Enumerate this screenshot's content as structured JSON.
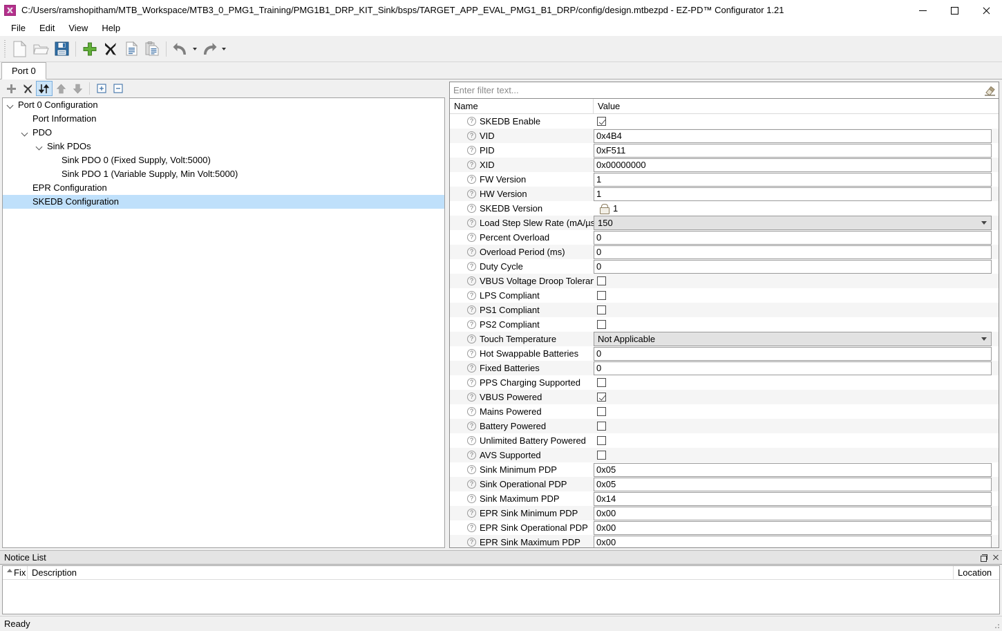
{
  "window": {
    "title": "C:/Users/ramshopitham/MTB_Workspace/MTB3_0_PMG1_Training/PMG1B1_DRP_KIT_Sink/bsps/TARGET_APP_EVAL_PMG1_B1_DRP/config/design.mtbezpd - EZ-PD™ Configurator 1.21",
    "app_icon": "ezpd-app-icon",
    "minimize": "minimize-icon",
    "maximize": "maximize-icon",
    "close": "close-icon"
  },
  "menubar": {
    "items": [
      {
        "label": "File"
      },
      {
        "label": "Edit"
      },
      {
        "label": "View"
      },
      {
        "label": "Help"
      }
    ]
  },
  "toolbar": {
    "buttons": [
      {
        "name": "new-file-icon",
        "tip": "New"
      },
      {
        "name": "open-folder-icon",
        "tip": "Open"
      },
      {
        "name": "save-icon",
        "tip": "Save"
      },
      {
        "name": "add-icon",
        "tip": "Add"
      },
      {
        "name": "delete-icon",
        "tip": "Delete"
      },
      {
        "name": "copy-icon",
        "tip": "Copy"
      },
      {
        "name": "paste-icon",
        "tip": "Paste"
      },
      {
        "name": "undo-icon",
        "tip": "Undo"
      },
      {
        "name": "redo-icon",
        "tip": "Redo"
      }
    ]
  },
  "tabs": [
    {
      "label": "Port 0",
      "active": true
    }
  ],
  "tree_toolbar": {
    "buttons": [
      {
        "name": "tree-add-icon",
        "active": false
      },
      {
        "name": "tree-delete-icon",
        "active": false
      },
      {
        "name": "tree-sort-icon",
        "active": true
      },
      {
        "name": "tree-move-up-icon",
        "active": false
      },
      {
        "name": "tree-move-down-icon",
        "active": false
      },
      {
        "name": "tree-expand-all-icon",
        "active": false
      },
      {
        "name": "tree-collapse-all-icon",
        "active": false
      }
    ]
  },
  "tree": {
    "items": [
      {
        "label": "Port 0 Configuration",
        "indent": 0,
        "expandable": true,
        "expanded": true,
        "selected": false
      },
      {
        "label": "Port Information",
        "indent": 1,
        "expandable": false,
        "expanded": false,
        "selected": false
      },
      {
        "label": "PDO",
        "indent": 1,
        "expandable": true,
        "expanded": true,
        "selected": false
      },
      {
        "label": "Sink PDOs",
        "indent": 2,
        "expandable": true,
        "expanded": true,
        "selected": false
      },
      {
        "label": "Sink PDO 0 (Fixed Supply, Volt:5000)",
        "indent": 3,
        "expandable": false,
        "expanded": false,
        "selected": false
      },
      {
        "label": "Sink PDO 1 (Variable Supply, Min Volt:5000)",
        "indent": 3,
        "expandable": false,
        "expanded": false,
        "selected": false
      },
      {
        "label": "EPR Configuration",
        "indent": 1,
        "expandable": false,
        "expanded": false,
        "selected": false
      },
      {
        "label": "SKEDB Configuration",
        "indent": 1,
        "expandable": false,
        "expanded": false,
        "selected": true
      }
    ]
  },
  "filter": {
    "value": "",
    "placeholder": "Enter filter text...",
    "clear_icon": "eraser-icon"
  },
  "grid": {
    "columns": {
      "name": "Name",
      "value": "Value"
    },
    "rows": [
      {
        "name": "SKEDB Enable",
        "type": "checkbox",
        "checked": true,
        "value": ""
      },
      {
        "name": "VID",
        "type": "text",
        "value": "0x4B4"
      },
      {
        "name": "PID",
        "type": "text",
        "value": "0xF511"
      },
      {
        "name": "XID",
        "type": "text",
        "value": "0x00000000"
      },
      {
        "name": "FW Version",
        "type": "text",
        "value": "1"
      },
      {
        "name": "HW Version",
        "type": "text",
        "value": "1"
      },
      {
        "name": "SKEDB Version",
        "type": "locked",
        "value": "1"
      },
      {
        "name": "Load Step Slew Rate (mA/µs)",
        "type": "combo",
        "value": "150"
      },
      {
        "name": "Percent Overload",
        "type": "text",
        "value": "0"
      },
      {
        "name": "Overload Period (ms)",
        "type": "text",
        "value": "0"
      },
      {
        "name": "Duty Cycle",
        "type": "text",
        "value": "0"
      },
      {
        "name": "VBUS Voltage Droop Tolerance",
        "type": "checkbox",
        "checked": false,
        "value": ""
      },
      {
        "name": "LPS Compliant",
        "type": "checkbox",
        "checked": false,
        "value": ""
      },
      {
        "name": "PS1 Compliant",
        "type": "checkbox",
        "checked": false,
        "value": ""
      },
      {
        "name": "PS2 Compliant",
        "type": "checkbox",
        "checked": false,
        "value": ""
      },
      {
        "name": "Touch Temperature",
        "type": "combo",
        "value": "Not Applicable"
      },
      {
        "name": "Hot Swappable Batteries",
        "type": "text",
        "value": "0"
      },
      {
        "name": "Fixed Batteries",
        "type": "text",
        "value": "0"
      },
      {
        "name": "PPS Charging Supported",
        "type": "checkbox",
        "checked": false,
        "value": ""
      },
      {
        "name": "VBUS Powered",
        "type": "checkbox",
        "checked": true,
        "value": ""
      },
      {
        "name": "Mains Powered",
        "type": "checkbox",
        "checked": false,
        "value": ""
      },
      {
        "name": "Battery Powered",
        "type": "checkbox",
        "checked": false,
        "value": ""
      },
      {
        "name": "Unlimited Battery Powered",
        "type": "checkbox",
        "checked": false,
        "value": ""
      },
      {
        "name": "AVS Supported",
        "type": "checkbox",
        "checked": false,
        "value": ""
      },
      {
        "name": "Sink Minimum PDP",
        "type": "text",
        "value": "0x05"
      },
      {
        "name": "Sink Operational PDP",
        "type": "text",
        "value": "0x05"
      },
      {
        "name": "Sink Maximum PDP",
        "type": "text",
        "value": "0x14"
      },
      {
        "name": "EPR Sink Minimum PDP",
        "type": "text",
        "value": "0x00"
      },
      {
        "name": "EPR Sink Operational PDP",
        "type": "text",
        "value": "0x00"
      },
      {
        "name": "EPR Sink Maximum PDP",
        "type": "text",
        "value": "0x00"
      }
    ],
    "help_glyph": "?"
  },
  "notice_list": {
    "title": "Notice List",
    "restore_icon": "restore-icon",
    "close_icon": "close-icon",
    "columns": {
      "fix": "Fix",
      "description": "Description",
      "location": "Location"
    },
    "rows": []
  },
  "statusbar": {
    "text": "Ready"
  },
  "colors": {
    "selection": "#bfe0fb",
    "toolbar_active": "#cce4f7",
    "row_alt": "#f5f5f5",
    "combo_bg": "#e2e2e2",
    "accent_save": "#2f6fa8",
    "accent_add": "#5aa731",
    "app_icon": "#b4308c"
  }
}
